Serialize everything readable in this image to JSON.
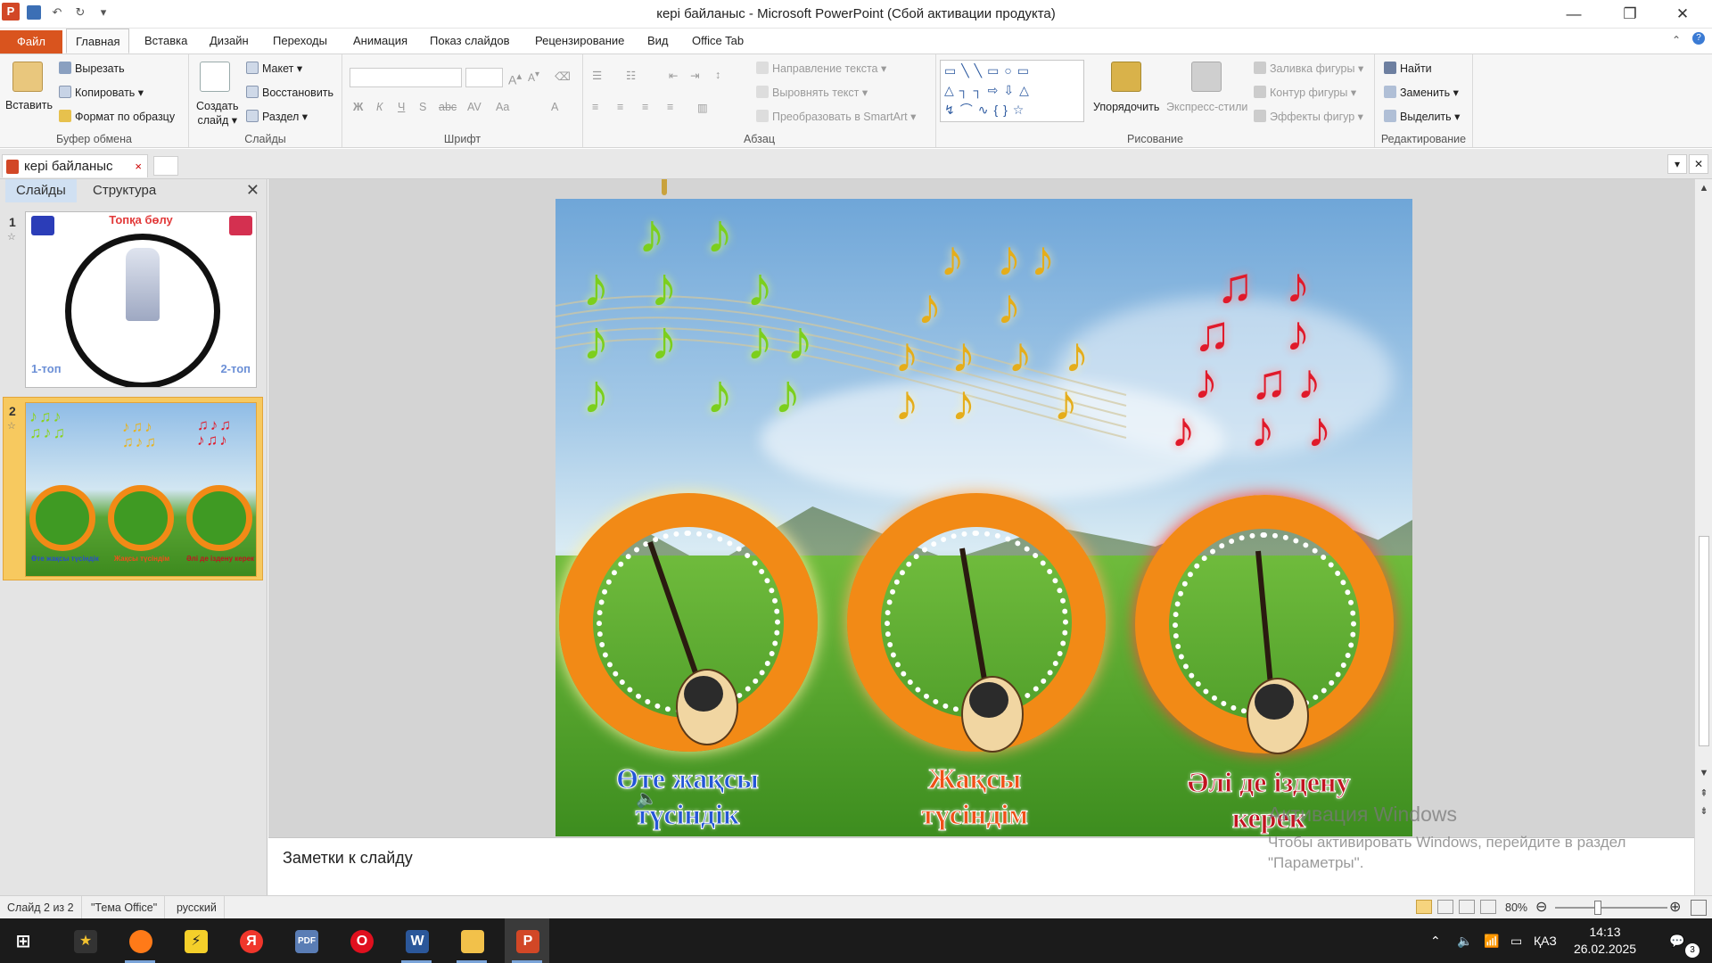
{
  "window": {
    "app_icon": "P",
    "title": "кері байланыс  -  Microsoft PowerPoint (Сбой активации продукта)",
    "minimize_icon": "—",
    "restore_icon": "❐",
    "close_icon": "✕"
  },
  "ribbon_tabs": [
    "Файл",
    "Главная",
    "Вставка",
    "Дизайн",
    "Переходы",
    "Анимация",
    "Показ слайдов",
    "Рецензирование",
    "Вид",
    "Office Tab"
  ],
  "clipboard": {
    "paste": "Вставить",
    "cut": "Вырезать",
    "copy": "Копировать",
    "format_painter": "Формат по образцу",
    "label": "Буфер обмена"
  },
  "slides_group": {
    "new_slide_line1": "Создать",
    "new_slide_line2": "слайд",
    "layout": "Макет",
    "reset": "Восстановить",
    "section": "Раздел",
    "label": "Слайды"
  },
  "font_group": {
    "label": "Шрифт"
  },
  "paragraph_group": {
    "text_direction": "Направление текста",
    "align_text": "Выровнять текст",
    "smartart": "Преобразовать в SmartArt",
    "label": "Абзац"
  },
  "drawing_group": {
    "arrange": "Упорядочить",
    "quick_styles": "Экспресс-стили",
    "shape_fill": "Заливка фигуры",
    "shape_outline": "Контур фигуры",
    "shape_effects": "Эффекты фигур",
    "label": "Рисование"
  },
  "editing_group": {
    "find": "Найти",
    "replace": "Заменить",
    "select": "Выделить",
    "label": "Редактирование"
  },
  "doc_tab": {
    "title": "кері байланыс",
    "close": "×"
  },
  "left_panel": {
    "tab_slides": "Слайды",
    "tab_outline": "Структура",
    "close": "✕",
    "slide1": {
      "number": "1",
      "title": "Топқа бөлу",
      "group1": "1-топ",
      "group2": "2-топ"
    },
    "slide2": {
      "number": "2",
      "cap1": "Өте жақсы түсіндік",
      "cap2": "Жақсы түсіндім",
      "cap3": "Әлі де іздену керек"
    }
  },
  "slide": {
    "caption1_line1": "Өте жақсы",
    "caption1_line2": "түсіндік",
    "caption2_line1": "Жақсы",
    "caption2_line2": "түсіндім",
    "caption3_line1": "Әлі де іздену",
    "caption3_line2": "керек"
  },
  "notes": {
    "placeholder": "Заметки к слайду"
  },
  "activation": {
    "line1": "Активация Windows",
    "line2": "Чтобы активировать Windows, перейдите в раздел",
    "line3": "\"Параметры\"."
  },
  "status": {
    "slide_of": "Слайд 2 из 2",
    "theme": "\"Тема Office\"",
    "language": "русский",
    "zoom": "80%"
  },
  "taskbar": {
    "language": "ҚАЗ",
    "time": "14:13",
    "date": "26.02.2025",
    "notifications": "3"
  },
  "colors": {
    "file_tab": "#d9541e",
    "accent_green": "#7ccf1c",
    "accent_gold": "#e5ad1a",
    "accent_red": "#e01a2a",
    "frame_orange": "#f28a16"
  }
}
